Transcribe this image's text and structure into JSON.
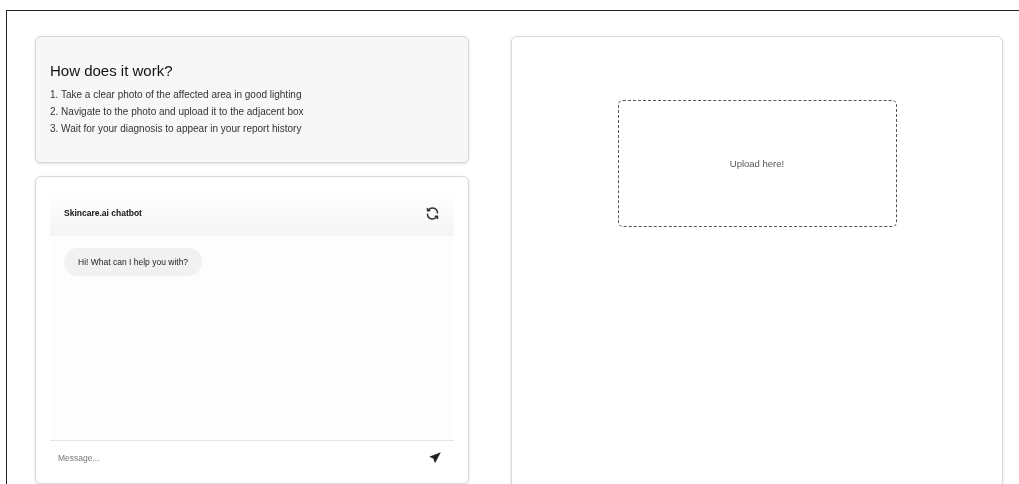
{
  "how_it_works": {
    "title": "How does it work?",
    "steps": [
      "1. Take a clear photo of the affected area in good lighting",
      "2. Navigate to the photo and upload it to the adjacent box",
      "3. Wait for your diagnosis to appear in your report history"
    ]
  },
  "chatbot": {
    "title": "Skincare.ai chatbot",
    "messages": [
      {
        "text": "Hi! What can I help you with?"
      }
    ],
    "input": {
      "placeholder": "Message..."
    }
  },
  "upload": {
    "label": "Upload here!"
  }
}
